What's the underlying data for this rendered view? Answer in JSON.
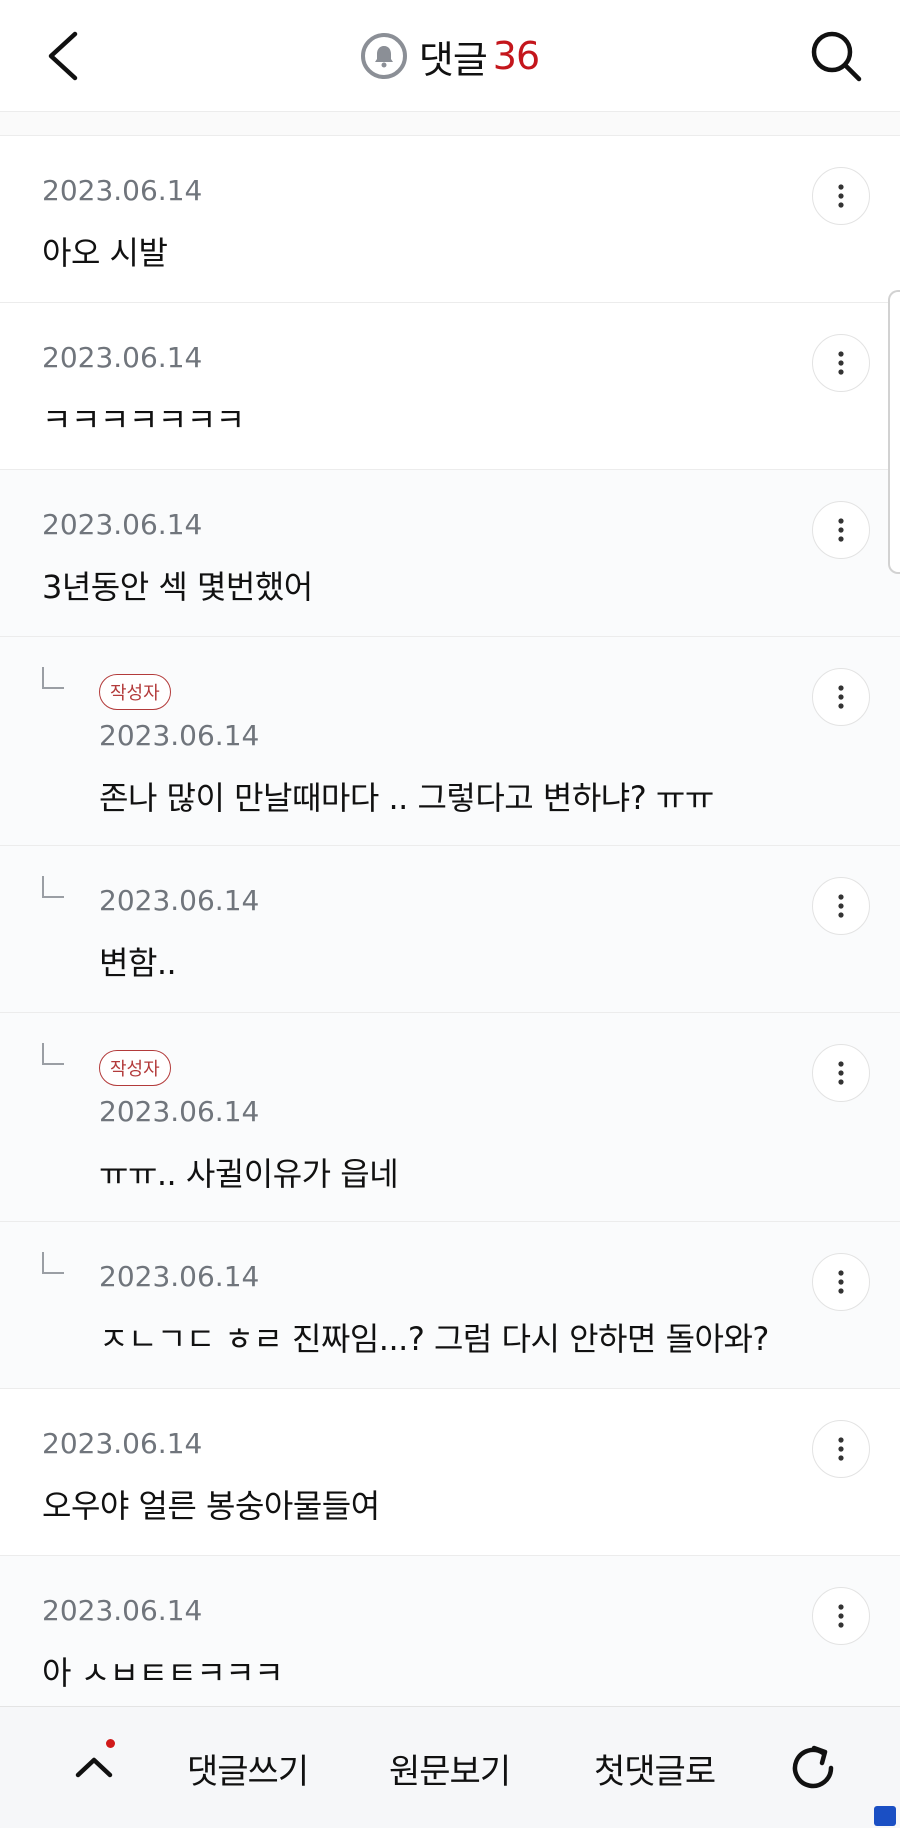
{
  "header": {
    "back_icon": "chevron-left-icon",
    "bell_icon": "bell-icon",
    "title": "댓글",
    "count": "36",
    "search_icon": "search-icon"
  },
  "comments": [
    {
      "date": "2023.06.14",
      "text": "아오 시발",
      "reply": false,
      "author": false
    },
    {
      "date": "2023.06.14",
      "text": "ㅋㅋㅋㅋㅋㅋㅋ",
      "reply": false,
      "author": false
    },
    {
      "date": "2023.06.14",
      "text": "3년동안 섹 몇번했어",
      "reply": false,
      "author": false
    },
    {
      "date": "2023.06.14",
      "text": "존나 많이 만날때마다 .. 그렇다고 변하냐? ㅠㅠ",
      "reply": true,
      "author": true,
      "badge": "작성자"
    },
    {
      "date": "2023.06.14",
      "text": "변함..",
      "reply": true,
      "author": false
    },
    {
      "date": "2023.06.14",
      "text": "ㅠㅠ.. 사귈이유가 읍네",
      "reply": true,
      "author": true,
      "badge": "작성자"
    },
    {
      "date": "2023.06.14",
      "text": "ㅈㄴㄱㄷ ㅎㄹ 진짜임...? 그럼 다시 안하면 돌아와?",
      "reply": true,
      "author": false
    },
    {
      "date": "2023.06.14",
      "text": "오우야 얼른 봉숭아물들여",
      "reply": false,
      "author": false
    },
    {
      "date": "2023.06.14",
      "text": "아 ㅅㅂㅌㅌㅋㅋㅋ",
      "reply": false,
      "author": false
    }
  ],
  "bottom_bar": {
    "up_icon": "chevron-up-icon",
    "write_label": "댓글쓰기",
    "original_label": "원문보기",
    "first_comment_label": "첫댓글로",
    "refresh_icon": "refresh-icon"
  },
  "colors": {
    "accent": "#c4161c",
    "badge": "#b33b3b",
    "date": "#70757c"
  }
}
